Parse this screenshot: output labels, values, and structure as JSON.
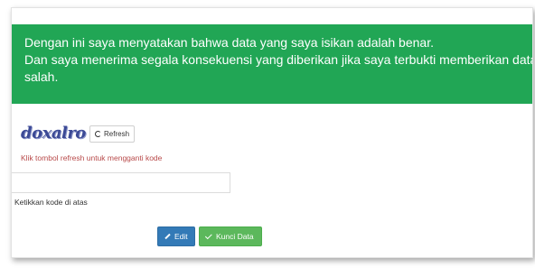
{
  "alert": {
    "line1": "Dengan ini saya menyatakan bahwa data yang saya isikan adalah benar.",
    "line2": "Dan saya menerima segala konsekuensi yang diberikan jika saya terbukti memberikan data yang",
    "line3": "salah."
  },
  "captcha": {
    "code": "doxalro",
    "refresh_label": "Refresh",
    "refresh_hint": "Klik tombol refresh untuk mengganti kode",
    "input_value": "",
    "input_help": "Ketikkan kode di atas"
  },
  "actions": {
    "edit_label": "Edit",
    "lock_label": "Kunci Data"
  },
  "colors": {
    "alert_bg": "#21a655",
    "edit_btn": "#337ab7",
    "lock_btn": "#5cb85c",
    "hint_red": "#b84a4a"
  },
  "icons": {
    "refresh": "refresh-icon",
    "edit": "pencil-icon",
    "lock": "check-icon"
  }
}
